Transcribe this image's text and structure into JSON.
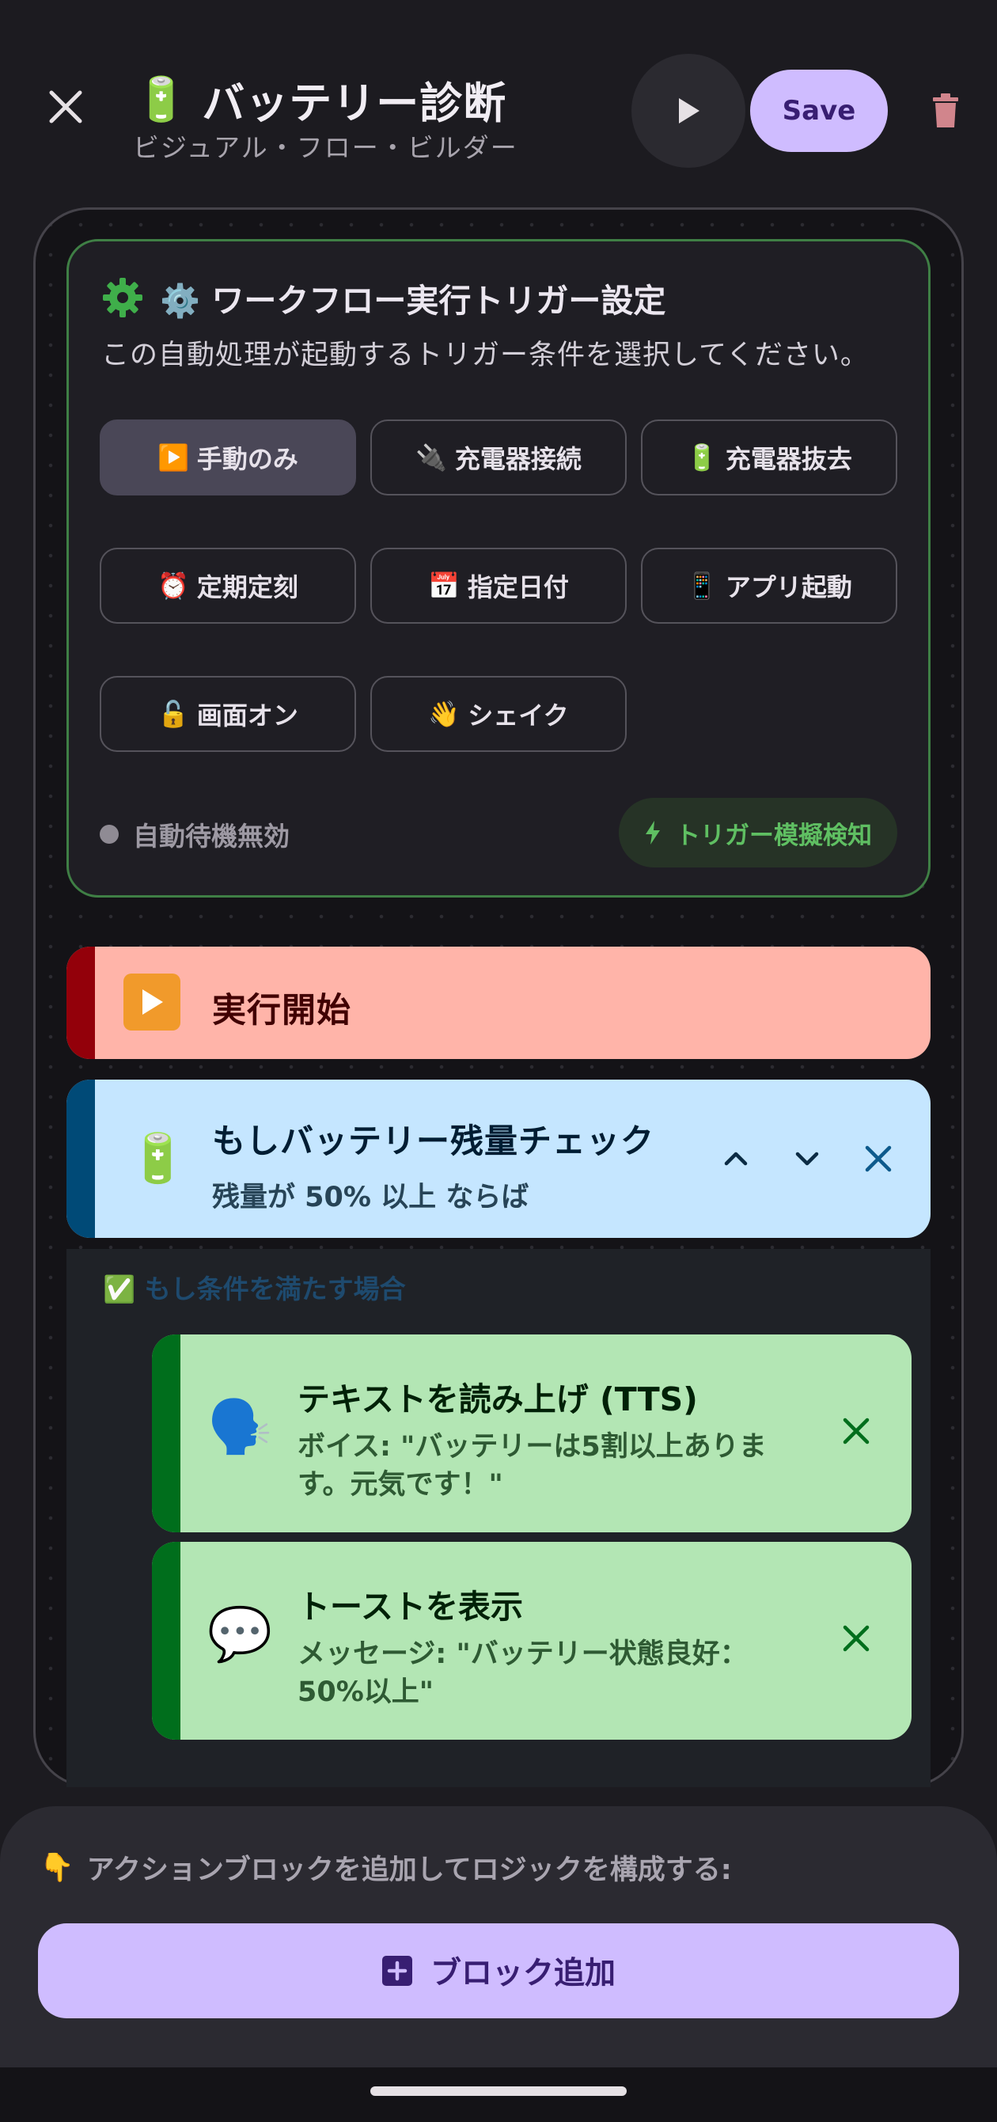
{
  "header": {
    "title_icon": "🔋",
    "title": "バッテリー診断",
    "subtitle": "ビジュアル・フロー・ビルダー",
    "save_label": "Save"
  },
  "trigger": {
    "title": "⚙️ ワークフロー実行トリガー設定",
    "description": "この自動処理が起動するトリガー条件を選択してください。",
    "options": [
      {
        "icon": "▶️",
        "label": "手動のみ",
        "selected": true
      },
      {
        "icon": "🔌",
        "label": "充電器接続",
        "selected": false
      },
      {
        "icon": "🔋",
        "label": "充電器抜去",
        "selected": false
      },
      {
        "icon": "⏰",
        "label": "定期定刻",
        "selected": false
      },
      {
        "icon": "📅",
        "label": "指定日付",
        "selected": false
      },
      {
        "icon": "📱",
        "label": "アプリ起動",
        "selected": false
      },
      {
        "icon": "🔓",
        "label": "画面オン",
        "selected": false
      },
      {
        "icon": "👋",
        "label": "シェイク",
        "selected": false
      }
    ],
    "status_label": "自動待機無効",
    "simulate_label": "トリガー模擬検知"
  },
  "flow": {
    "start": {
      "icon": "▶️",
      "label": "実行開始"
    },
    "if_block": {
      "icon": "🔋",
      "title": "もしバッテリー残量チェック",
      "subtitle": "残量が 50% 以上 ならば"
    },
    "then_label": "✅ もし条件を満たす場合",
    "actions": [
      {
        "icon": "🗣️",
        "title": "テキストを読み上げ (TTS)",
        "subtitle": "ボイス: \"バッテリーは5割以上あります。元気です！\""
      },
      {
        "icon": "💬",
        "title": "トーストを表示",
        "subtitle": "メッセージ: \"バッテリー状態良好：50%以上\""
      }
    ]
  },
  "bottom": {
    "hint_icon": "👇",
    "hint": "アクションブロックを追加してロジックを構成する:",
    "add_block_label": "ブロック追加"
  },
  "colors": {
    "accent": "#cfbcff",
    "trigger_border": "#3f7f45",
    "start_block": "#ffb4a9",
    "if_block": "#c5e6ff",
    "action_block": "#b3e6b4"
  }
}
